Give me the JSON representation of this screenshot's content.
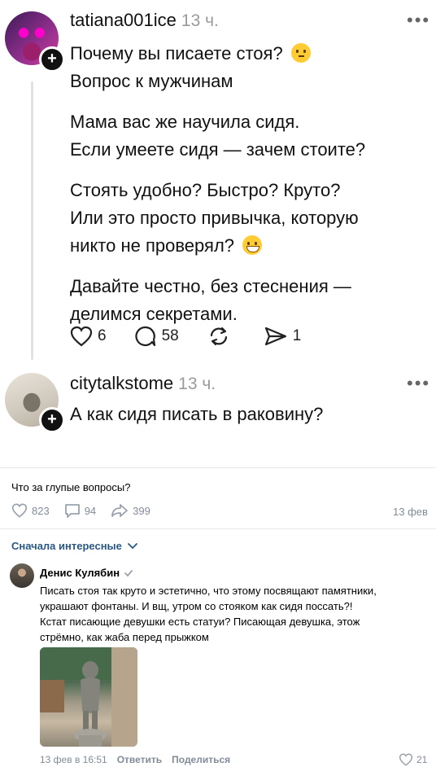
{
  "post1": {
    "username": "tatiana001ice",
    "time": "13 ч.",
    "lines": [
      [
        "Почему вы писаете стоя?",
        "Вопрос к мужчинам"
      ],
      [
        "Мама вас же научила сидя.",
        "Если умеете сидя — зачем стоите?"
      ],
      [
        "Стоять удобно? Быстро? Круто?",
        "Или это просто привычка, которую",
        "никто не проверял?"
      ],
      [
        "Давайте честно, без стеснения —",
        "делимся секретами."
      ]
    ],
    "likes": "6",
    "comments": "58",
    "shares": "1",
    "emoji_1": "thinking-face",
    "emoji_2": "grinning-face"
  },
  "post2": {
    "username": "citytalkstome",
    "time": "13 ч.",
    "text": "А как сидя писать в раковину?"
  },
  "vk_post": {
    "text": "Что за глупые вопросы?",
    "likes": "823",
    "comments": "94",
    "reposts": "399",
    "date": "13 фев"
  },
  "sort": {
    "label": "Сначала интересные"
  },
  "comment": {
    "author": "Денис Кулябин",
    "text_lines": [
      "Писать стоя так круто и эстетично, что этому посвящают памятники,",
      "украшают фонтаны. И вщ, утром со стояком как сидя поссать?!",
      "Кстат писающие девушки есть статуи? Писающая девушка, этож",
      "стрёмно, как жаба перед прыжком"
    ],
    "date": "13 фев в 16:51",
    "reply": "Ответить",
    "share": "Поделиться",
    "likes": "21"
  },
  "colors": {
    "vk_link": "#2a5885",
    "vk_meta": "#818c99",
    "verified": "#99a2ad"
  }
}
